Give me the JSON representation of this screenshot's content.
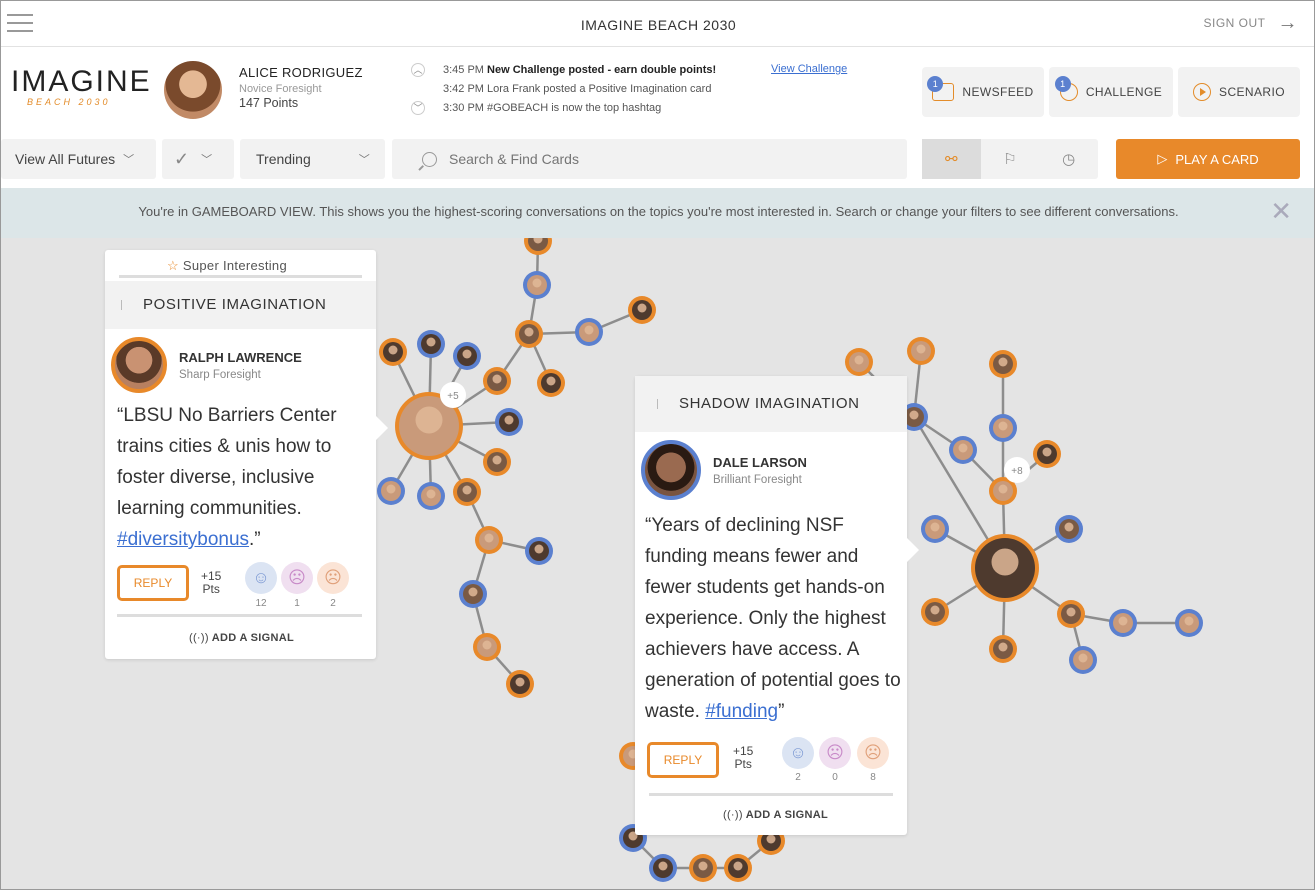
{
  "titlebar": {
    "title": "IMAGINE BEACH 2030",
    "signout_label": "SIGN OUT"
  },
  "logo": {
    "line1": "IMAGINE",
    "line2": "BEACH 2030"
  },
  "user": {
    "name": "ALICE RODRIGUEZ",
    "level": "Novice Foresight",
    "points": "147 Points"
  },
  "notifications": [
    {
      "time": "3:45 PM",
      "text": "New Challenge posted - earn double points!",
      "bold": true
    },
    {
      "time": "3:42 PM",
      "text": "Lora Frank posted a Positive Imagination card",
      "bold": false
    },
    {
      "time": "3:30 PM",
      "text": "#GOBEACH is now the top hashtag",
      "bold": false
    }
  ],
  "view_challenge_label": "View Challenge",
  "header_buttons": {
    "newsfeed": {
      "label": "NEWSFEED",
      "badge": "1"
    },
    "challenge": {
      "label": "CHALLENGE",
      "badge": "1"
    },
    "scenario": {
      "label": "SCENARIO"
    }
  },
  "filters": {
    "futures": "View All Futures",
    "sort": "Trending",
    "search_placeholder": "Search & Find Cards",
    "play_card_label": "PLAY A CARD"
  },
  "info": {
    "message": "You're in GAMEBOARD VIEW. This shows you the highest-scoring conversations on the topics you're most interested in. Search or change your filters to see different conversations."
  },
  "card1": {
    "badge": "Super Interesting",
    "category": "POSITIVE IMAGINATION",
    "author": "RALPH LAWRENCE",
    "level": "Sharp Foresight",
    "quote": "“LBSU No Barriers Center trains cities & unis how to foster diverse, inclusive learning communities.",
    "hashtag": "#diversitybonus",
    "quote_end": ".”",
    "reply": "REPLY",
    "pts": "+15",
    "pts_label": "Pts",
    "counts": [
      "12",
      "1",
      "2"
    ],
    "signal": "ADD A SIGNAL"
  },
  "card2": {
    "category": "SHADOW IMAGINATION",
    "author": "DALE LARSON",
    "level": "Brilliant Foresight",
    "quote": "“Years of declining NSF funding means fewer and fewer students get hands-on experience. Only the highest achievers have access. A generation of potential goes to waste.",
    "hashtag": "#funding",
    "quote_end": "”",
    "reply": "REPLY",
    "pts": "+15",
    "pts_label": "Pts",
    "counts": [
      "2",
      "0",
      "8"
    ],
    "signal": "ADD A SIGNAL"
  },
  "graph": {
    "more1": "+5",
    "more2": "+8"
  },
  "colors": {
    "accent": "#e8892a",
    "blue": "#5b80cf"
  }
}
